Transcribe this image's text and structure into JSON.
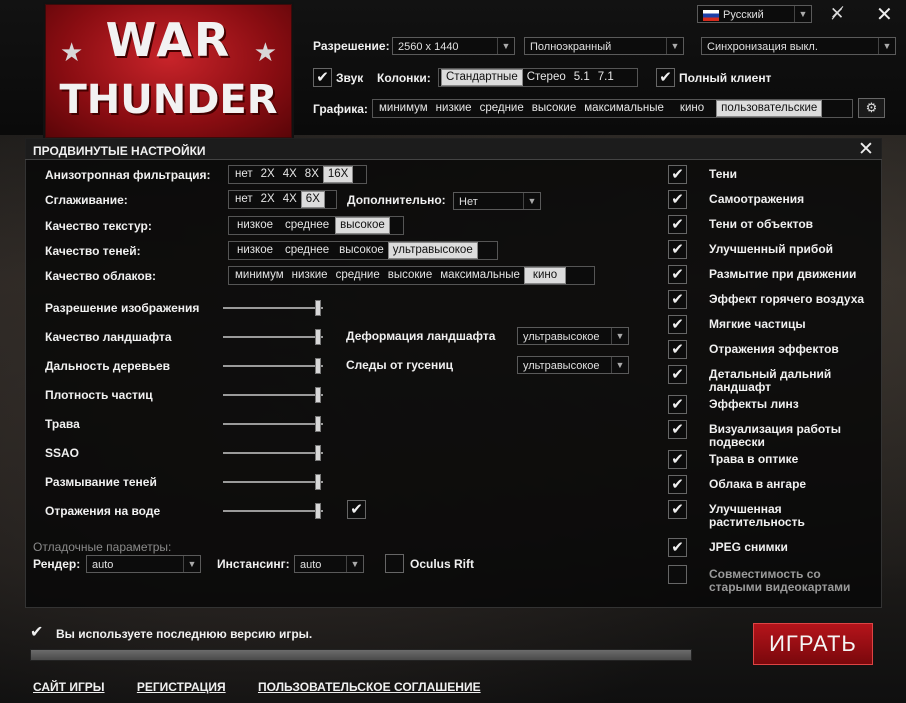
{
  "language": {
    "value": "Русский",
    "flag_colors": [
      "#ffffff",
      "#1c3fa8",
      "#d52b1e"
    ]
  },
  "resolution": {
    "label": "Разрешение:",
    "value": "2560 x 1440"
  },
  "display_mode": {
    "value": "Полноэкранный"
  },
  "vsync": {
    "value": "Синхронизация выкл."
  },
  "sound": {
    "label": "Звук",
    "checked": true
  },
  "speakers": {
    "label": "Колонки:",
    "options": [
      "Стандартные",
      "Стерео",
      "5.1",
      "7.1"
    ],
    "selected": "Стандартные"
  },
  "full_client": {
    "label": "Полный клиент",
    "checked": true
  },
  "graphics": {
    "label": "Графика:",
    "options": [
      "минимум",
      "низкие",
      "средние",
      "высокие",
      "максимальные",
      "кино",
      "пользовательские"
    ],
    "selected": "пользовательские"
  },
  "panel": {
    "title": "ПРОДВИНУТЫЕ НАСТРОЙКИ"
  },
  "aniso": {
    "label": "Анизотропная фильтрация:",
    "options": [
      "нет",
      "2X",
      "4X",
      "8X",
      "16X"
    ],
    "selected": "16X"
  },
  "aa": {
    "label": "Сглаживание:",
    "options": [
      "нет",
      "2X",
      "4X",
      "6X"
    ],
    "selected": "6X"
  },
  "extra": {
    "label": "Дополнительно:",
    "value": "Нет"
  },
  "texture": {
    "label": "Качество текстур:",
    "options": [
      "низкое",
      "среднее",
      "высокое"
    ],
    "selected": "высокое"
  },
  "shadow": {
    "label": "Качество теней:",
    "options": [
      "низкое",
      "среднее",
      "высокое",
      "ультравысокое"
    ],
    "selected": "ультравысокое"
  },
  "clouds": {
    "label": "Качество облаков:",
    "options": [
      "минимум",
      "низкие",
      "средние",
      "высокие",
      "максимальные",
      "кино"
    ],
    "selected": "кино"
  },
  "sliders": [
    {
      "label": "Разрешение изображения",
      "level": 0.95
    },
    {
      "label": "Качество ландшафта",
      "level": 0.95
    },
    {
      "label": "Дальность деревьев",
      "level": 0.95
    },
    {
      "label": "Плотность частиц",
      "level": 0.95
    },
    {
      "label": "Трава",
      "level": 0.95
    },
    {
      "label": "SSAO",
      "level": 0.95
    },
    {
      "label": "Размывание теней",
      "level": 0.95
    },
    {
      "label": "Отражения на воде",
      "level": 0.95
    }
  ],
  "water_reflection_checked": true,
  "terrain_deform": {
    "label": "Деформация ландшафта",
    "value": "ультравысокое"
  },
  "tracks": {
    "label": "Следы от гусениц",
    "value": "ультравысокое"
  },
  "debug": {
    "title": "Отладочные параметры:"
  },
  "render": {
    "label": "Рендер:",
    "value": "auto"
  },
  "instancing": {
    "label": "Инстансинг:",
    "value": "auto"
  },
  "oculus": {
    "label": "Oculus Rift",
    "checked": false
  },
  "checkboxes": [
    {
      "label": "Тени",
      "checked": true
    },
    {
      "label": "Самоотражения",
      "checked": true
    },
    {
      "label": "Тени от объектов",
      "checked": true
    },
    {
      "label": "Улучшенный прибой",
      "checked": true
    },
    {
      "label": "Размытие при движении",
      "checked": true
    },
    {
      "label": "Эффект горячего воздуха",
      "checked": true
    },
    {
      "label": "Мягкие частицы",
      "checked": true
    },
    {
      "label": "Отражения эффектов",
      "checked": true
    },
    {
      "label": "Детальный дальний ландшафт",
      "checked": true
    },
    {
      "label": "Эффекты линз",
      "checked": true
    },
    {
      "label": "Визуализация работы подвески",
      "checked": true
    },
    {
      "label": "Трава в оптике",
      "checked": true
    },
    {
      "label": "Облака в ангаре",
      "checked": true
    },
    {
      "label": "Улучшенная растительность",
      "checked": true
    },
    {
      "label": "JPEG снимки",
      "checked": true
    },
    {
      "label": "Совместимость со старыми видеокартами",
      "checked": false
    }
  ],
  "status": {
    "text": "Вы используете последнюю версию игры.",
    "progress": 1.0
  },
  "play": {
    "label": "ИГРАТЬ"
  },
  "footer": {
    "site": "САЙТ ИГРЫ",
    "register": "РЕГИСТРАЦИЯ",
    "agreement": "ПОЛЬЗОВАТЕЛЬСКОЕ СОГЛАШЕНИЕ"
  },
  "logo": {
    "line1": "WAR",
    "line2": "THUNDER"
  },
  "colors": {
    "accent": "#b5141b",
    "panel_bg": "#080808",
    "text": "#f0f0f0"
  }
}
